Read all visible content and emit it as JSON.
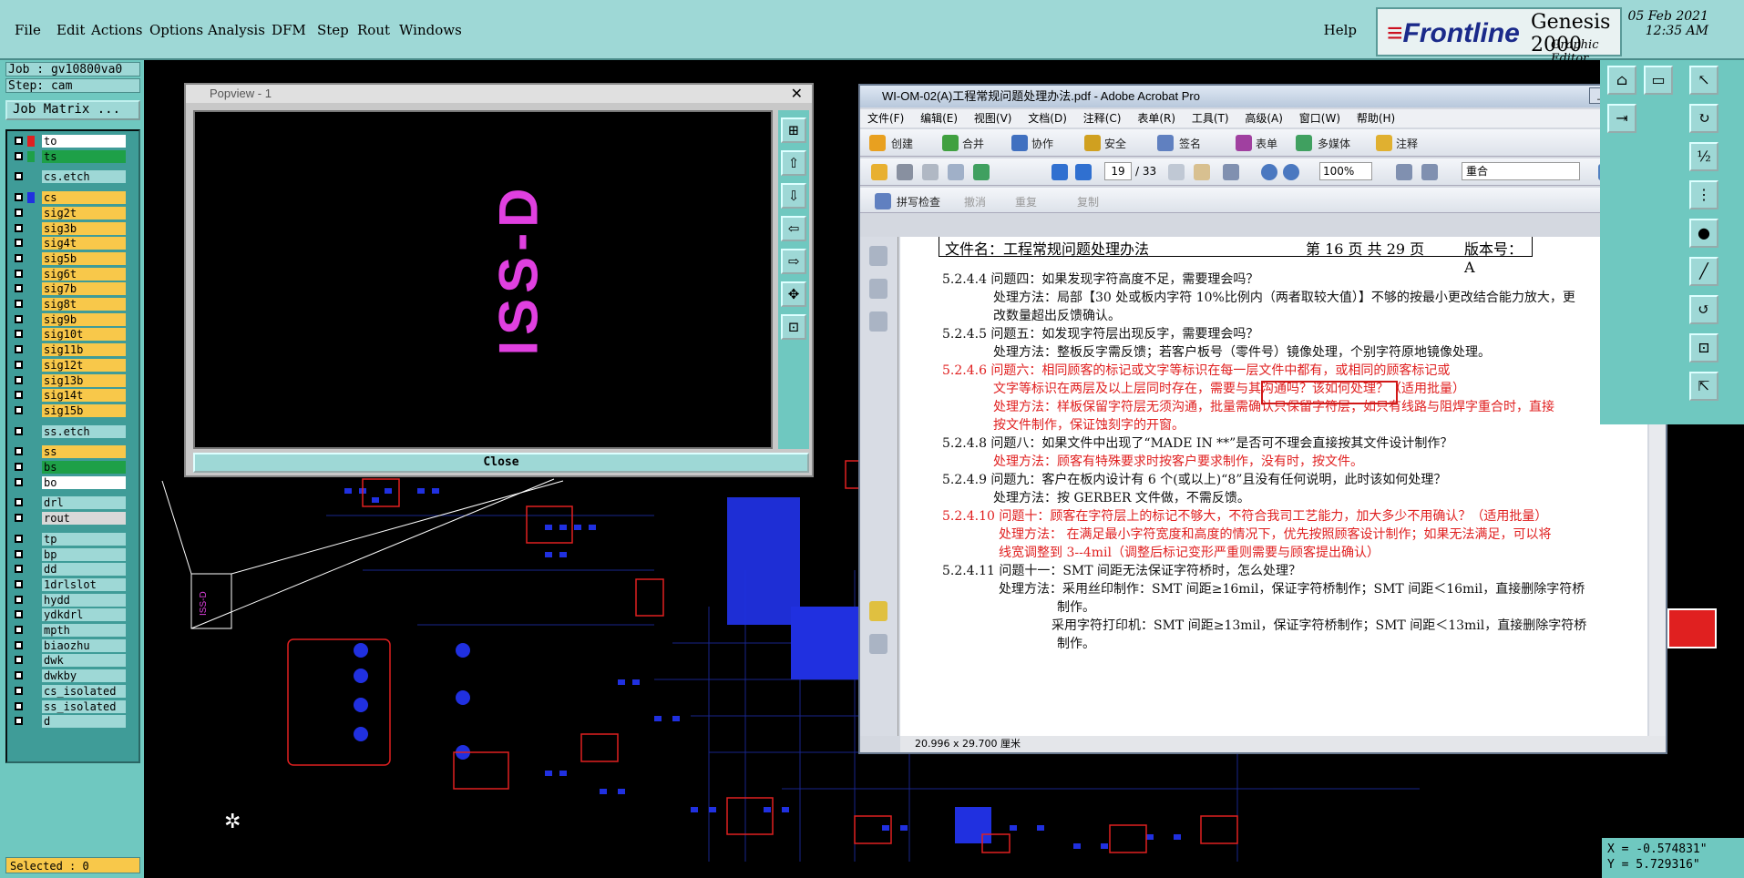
{
  "menubar": {
    "items": [
      "File",
      "Edit",
      "Actions",
      "Options",
      "Analysis",
      "DFM",
      "Step",
      "Rout",
      "Windows"
    ],
    "help": "Help",
    "logo": "Frontline",
    "product": "Genesis 2000",
    "product_sub": "Graphic Editor",
    "date": "05 Feb 2021",
    "time": "12:35 AM"
  },
  "leftpanel": {
    "job": "Job : gv10800va0",
    "step": "Step: cam",
    "job_matrix": "Job Matrix ...",
    "selected": "Selected : 0"
  },
  "layers": [
    {
      "name": "to",
      "sw": "#e02020",
      "bg": "#ffffff"
    },
    {
      "name": "ts",
      "sw": "#1ea048",
      "bg": "#1ea048"
    },
    {
      "name": "cs.etch",
      "sw": "",
      "bg": "#9ed8d6"
    },
    {
      "name": "cs",
      "sw": "#2030e0",
      "bg": "#f8c84a"
    },
    {
      "name": "sig2t",
      "sw": "",
      "bg": "#f8c84a"
    },
    {
      "name": "sig3b",
      "sw": "",
      "bg": "#f8c84a"
    },
    {
      "name": "sig4t",
      "sw": "",
      "bg": "#f8c84a"
    },
    {
      "name": "sig5b",
      "sw": "",
      "bg": "#f8c84a"
    },
    {
      "name": "sig6t",
      "sw": "",
      "bg": "#f8c84a"
    },
    {
      "name": "sig7b",
      "sw": "",
      "bg": "#f8c84a"
    },
    {
      "name": "sig8t",
      "sw": "",
      "bg": "#f8c84a"
    },
    {
      "name": "sig9b",
      "sw": "",
      "bg": "#f8c84a"
    },
    {
      "name": "sig10t",
      "sw": "",
      "bg": "#f8c84a"
    },
    {
      "name": "sig11b",
      "sw": "",
      "bg": "#f8c84a"
    },
    {
      "name": "sig12t",
      "sw": "",
      "bg": "#f8c84a"
    },
    {
      "name": "sig13b",
      "sw": "",
      "bg": "#f8c84a"
    },
    {
      "name": "sig14t",
      "sw": "",
      "bg": "#f8c84a"
    },
    {
      "name": "sig15b",
      "sw": "",
      "bg": "#f8c84a"
    },
    {
      "name": "ss.etch",
      "sw": "",
      "bg": "#9ed8d6"
    },
    {
      "name": "ss",
      "sw": "",
      "bg": "#f8c84a"
    },
    {
      "name": "bs",
      "sw": "",
      "bg": "#1ea048"
    },
    {
      "name": "bo",
      "sw": "",
      "bg": "#ffffff"
    },
    {
      "name": "drl",
      "sw": "",
      "bg": "#9ed8d6"
    },
    {
      "name": "rout",
      "sw": "",
      "bg": "#d8d8d8"
    },
    {
      "name": "tp",
      "sw": "",
      "bg": "#9ed8d6"
    },
    {
      "name": "bp",
      "sw": "",
      "bg": "#9ed8d6"
    },
    {
      "name": "dd",
      "sw": "",
      "bg": "#9ed8d6"
    },
    {
      "name": "1drlslot",
      "sw": "",
      "bg": "#9ed8d6"
    },
    {
      "name": "hydd",
      "sw": "",
      "bg": "#9ed8d6"
    },
    {
      "name": "ydkdrl",
      "sw": "",
      "bg": "#9ed8d6"
    },
    {
      "name": "mpth",
      "sw": "",
      "bg": "#9ed8d6"
    },
    {
      "name": "biaozhu",
      "sw": "",
      "bg": "#9ed8d6"
    },
    {
      "name": "dwk",
      "sw": "",
      "bg": "#9ed8d6"
    },
    {
      "name": "dwkby",
      "sw": "",
      "bg": "#9ed8d6"
    },
    {
      "name": "cs_isolated",
      "sw": "",
      "bg": "#9ed8d6"
    },
    {
      "name": "ss_isolated",
      "sw": "",
      "bg": "#9ed8d6"
    },
    {
      "name": "d",
      "sw": "",
      "bg": "#9ed8d6"
    }
  ],
  "popview": {
    "title": "Popview - 1",
    "text": "ISS-D",
    "close": "Close"
  },
  "acrobat": {
    "title": "WI-OM-02(A)工程常规问题处理办法.pdf - Adobe Acrobat Pro",
    "menu": [
      "文件(F)",
      "编辑(E)",
      "视图(V)",
      "文档(D)",
      "注释(C)",
      "表单(R)",
      "工具(T)",
      "高级(A)",
      "窗口(W)",
      "帮助(H)"
    ],
    "toolbar1": [
      "创建",
      "合并",
      "协作",
      "安全",
      "签名",
      "表单",
      "多媒体",
      "注释"
    ],
    "page": "19",
    "page_total": "/ 33",
    "zoom": "100%",
    "view_mode": "重合",
    "toolbar3": [
      "拼写检查",
      "撤消",
      "重复",
      "复制"
    ],
    "status": "20.996 x 29.700 厘米",
    "header": {
      "file": "文件名：工程常规问题处理办法",
      "page": "第 16 页 共 29 页",
      "version": "版本号：A"
    },
    "lines": [
      {
        "t": "5.2.4.4 问题四：如果发现字符高度不足，需要理会吗？",
        "red": false
      },
      {
        "t": "处理方法：局部【30 处或板内字符 10%比例内（两者取较大值）】不够的按最小更改结合能力放大，更",
        "red": false
      },
      {
        "t": "改数量超出反馈确认。",
        "red": false
      },
      {
        "t": "5.2.4.5 问题五：如发现字符层出现反字，需要理会吗？",
        "red": false
      },
      {
        "t": "处理方法：整板反字需反馈；若客户板号（零件号）镜像处理，个别字符原地镜像处理。",
        "red": false
      },
      {
        "t": "5.2.4.6 问题六：相同顾客的标记或文字等标识在每一层文件中都有，或相同的顾客标记或",
        "red": true
      },
      {
        "t": "文字等标识在两层及以上层同时存在，需要与其沟通吗？该如何处理？（适用批量）",
        "red": true
      },
      {
        "t": "处理方法：样板保留字符层无须沟通，批量需确认只保留字符层；如只有线路与阻焊字重合时，直接",
        "red": true
      },
      {
        "t": "按文件制作，保证蚀刻字的开窗。",
        "red": true
      },
      {
        "t": "5.2.4.8 问题八：如果文件中出现了“MADE IN **”是否可不理会直接按其文件设计制作？",
        "red": false
      },
      {
        "t": "处理方法：顾客有特殊要求时按客户要求制作，没有时，按文件。",
        "red": true
      },
      {
        "t": "5.2.4.9 问题九：客户在板内设计有 6 个(或以上)“8”且没有任何说明，此时该如何处理？",
        "red": false
      },
      {
        "t": "处理方法：按 GERBER 文件做，不需反馈。",
        "red": false
      },
      {
        "t": "5.2.4.10 问题十：顾客在字符层上的标记不够大，不符合我司工艺能力，加大多少不用确认？（适用批量）",
        "red": true
      },
      {
        "t": "处理方法： 在满足最小字符宽度和高度的情况下，优先按照顾客设计制作；如果无法满足，可以将",
        "red": true
      },
      {
        "t": "线宽调整到 3--4mil（调整后标记变形严重则需要与顾客提出确认）",
        "red": true
      },
      {
        "t": "5.2.4.11 问题十一：SMT 间距无法保证字符桥时，怎么处理？",
        "red": false
      },
      {
        "t": "处理方法：采用丝印制作：SMT 间距≥16mil，保证字符桥制作；SMT 间距＜16mil，直接删除字符桥",
        "red": false
      },
      {
        "t": "制作。",
        "red": false
      },
      {
        "t": "采用字符打印机：SMT 间距≥13mil，保证字符桥制作；SMT 间距＜13mil，直接删除字符桥",
        "red": false
      },
      {
        "t": "制作。",
        "red": false
      }
    ]
  },
  "coords": {
    "x": "X = -0.574831\"",
    "y": "Y = 5.729316\""
  },
  "colors": {
    "teal": "#6fc8c0",
    "panel": "#9ed8d6",
    "yellow": "#f8c84a",
    "pcb_red": "#e02020",
    "pcb_blue": "#2030e0",
    "magenta": "#e040e0"
  }
}
